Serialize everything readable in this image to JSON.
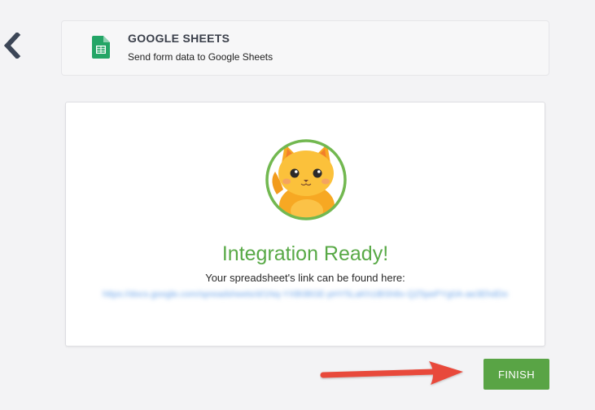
{
  "header": {
    "title": "GOOGLE SHEETS",
    "subtitle": "Send form data to Google Sheets",
    "icon": "google-sheets-icon"
  },
  "nav": {
    "back_icon": "chevron-left-icon"
  },
  "main": {
    "mascot_icon": "cat-mascot-icon",
    "title": "Integration Ready!",
    "link_label": "Your spreadsheet's link can be found here:",
    "link_url": "https://docs.google.com/spreadsheets/d/1Nq-YXB0BGE-pHY5LaKh1iBSh8x-QZ5pePYg0A-ae3EhdDo"
  },
  "footer": {
    "finish_label": "FINISH"
  },
  "colors": {
    "accent_green": "#59a445",
    "title_green": "#58a946",
    "arrow_red": "#e8493b",
    "link_blue": "#6aa3e8"
  }
}
